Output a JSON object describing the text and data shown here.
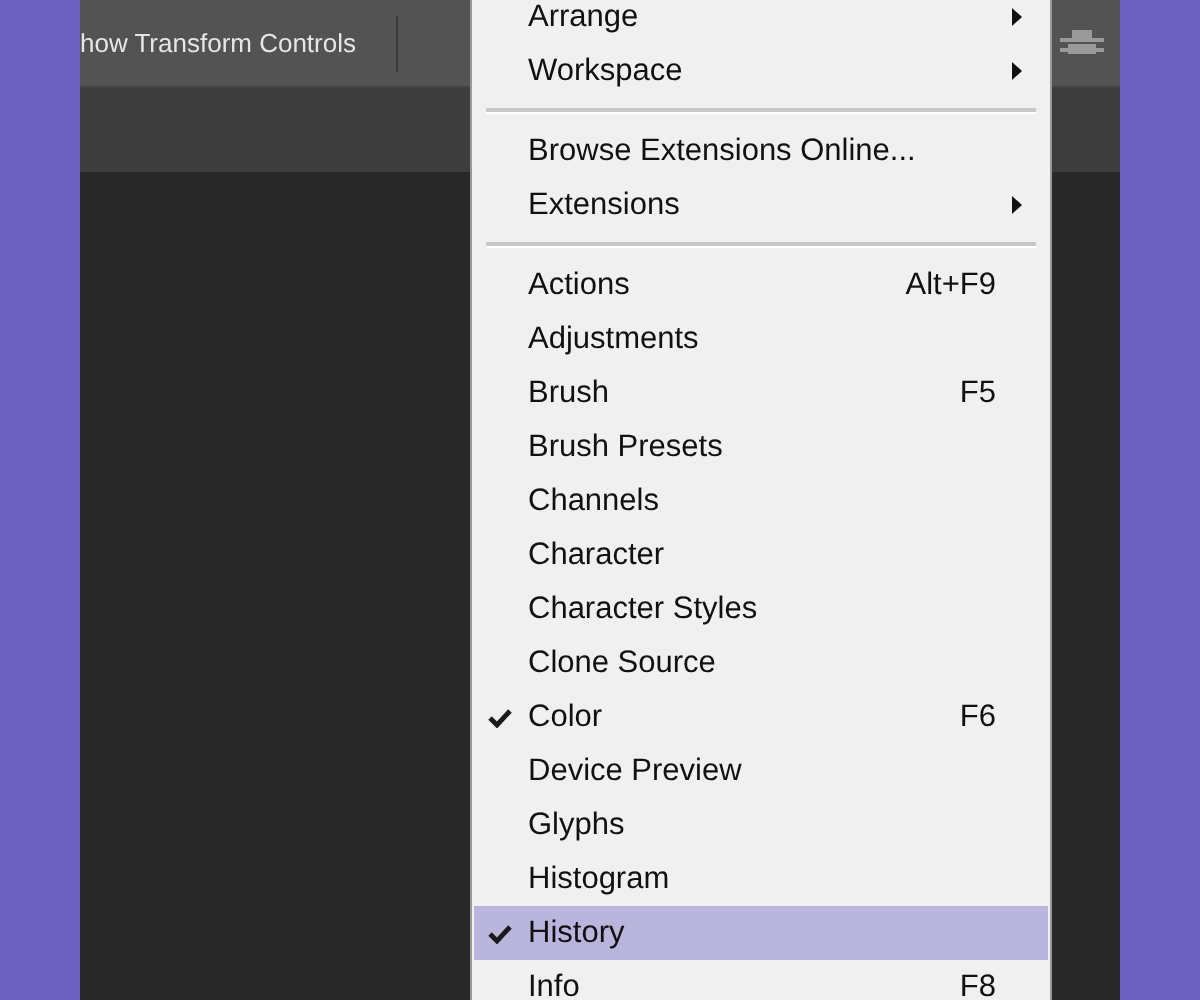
{
  "toolbar": {
    "option_label": "how Transform Controls"
  },
  "menu": {
    "items": [
      {
        "kind": "item",
        "label": "Arrange",
        "submenu": true
      },
      {
        "kind": "item",
        "label": "Workspace",
        "submenu": true
      },
      {
        "kind": "separator"
      },
      {
        "kind": "item",
        "label": "Browse Extensions Online..."
      },
      {
        "kind": "item",
        "label": "Extensions",
        "submenu": true
      },
      {
        "kind": "separator"
      },
      {
        "kind": "item",
        "label": "Actions",
        "shortcut": "Alt+F9"
      },
      {
        "kind": "item",
        "label": "Adjustments"
      },
      {
        "kind": "item",
        "label": "Brush",
        "shortcut": "F5"
      },
      {
        "kind": "item",
        "label": "Brush Presets"
      },
      {
        "kind": "item",
        "label": "Channels"
      },
      {
        "kind": "item",
        "label": "Character"
      },
      {
        "kind": "item",
        "label": "Character Styles"
      },
      {
        "kind": "item",
        "label": "Clone Source"
      },
      {
        "kind": "item",
        "label": "Color",
        "shortcut": "F6",
        "checked": true
      },
      {
        "kind": "item",
        "label": "Device Preview"
      },
      {
        "kind": "item",
        "label": "Glyphs"
      },
      {
        "kind": "item",
        "label": "Histogram"
      },
      {
        "kind": "item",
        "label": "History",
        "checked": true,
        "selected": true
      },
      {
        "kind": "item",
        "label": "Info",
        "shortcut": "F8"
      }
    ]
  }
}
